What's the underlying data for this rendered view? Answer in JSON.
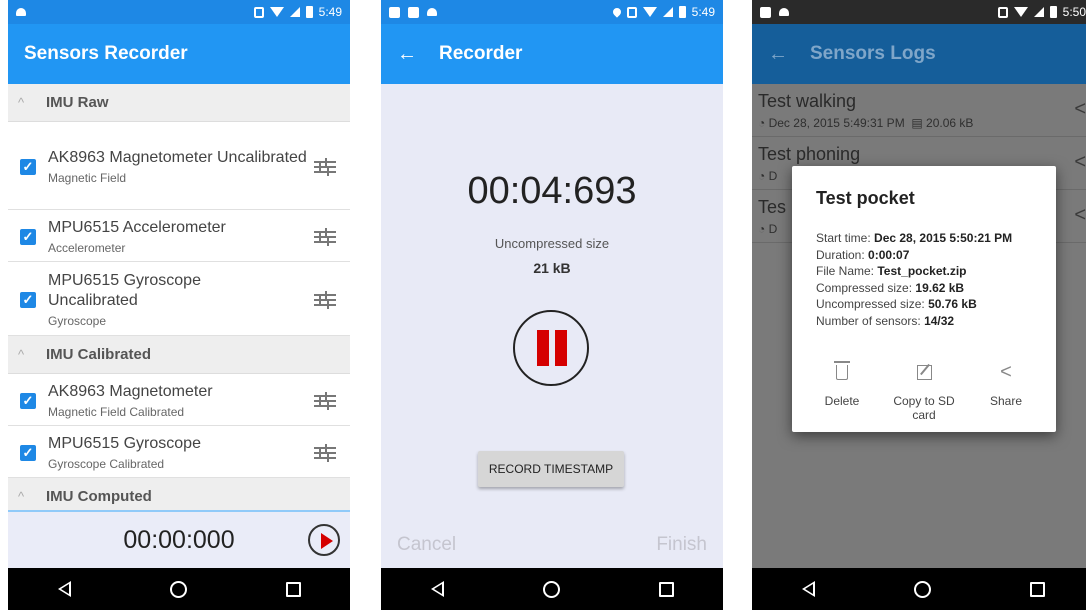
{
  "status": {
    "p1_time": "5:49",
    "p2_time": "5:49",
    "p3_time": "5:50"
  },
  "screen1": {
    "title": "Sensors Recorder",
    "sections": [
      {
        "title": "IMU Raw"
      },
      {
        "title": "IMU Calibrated"
      },
      {
        "title": "IMU Computed"
      }
    ],
    "sensors": [
      {
        "name": "AK8963 Magnetometer Uncalibrated",
        "type": "Magnetic Field",
        "checked": true
      },
      {
        "name": "MPU6515 Accelerometer",
        "type": "Accelerometer",
        "checked": true
      },
      {
        "name": "MPU6515 Gyroscope Uncalibrated",
        "type": "Gyroscope",
        "checked": true
      },
      {
        "name": "AK8963 Magnetometer",
        "type": "Magnetic Field Calibrated",
        "checked": true
      },
      {
        "name": "MPU6515 Gyroscope",
        "type": "Gyroscope Calibrated",
        "checked": true
      }
    ],
    "timer": "00:00:000"
  },
  "screen2": {
    "title": "Recorder",
    "elapsed": "00:04:693",
    "size_label": "Uncompressed size",
    "size_value": "21 kB",
    "timestamp_button": "RECORD TIMESTAMP",
    "cancel": "Cancel",
    "finish": "Finish"
  },
  "screen3": {
    "title": "Sensors Logs",
    "logs": [
      {
        "title": "Test walking",
        "date": "Dec 28, 2015 5:49:31 PM",
        "size": "20.06 kB"
      },
      {
        "title": "Test phoning",
        "date": "D"
      },
      {
        "title": "Tes",
        "date": "D"
      }
    ],
    "dialog": {
      "title": "Test pocket",
      "start_label": "Start time:",
      "start_value": "Dec 28, 2015 5:50:21 PM",
      "duration_label": "Duration:",
      "duration_value": "0:00:07",
      "file_label": "File Name:",
      "file_value": "Test_pocket.zip",
      "compressed_label": "Compressed size:",
      "compressed_value": "19.62 kB",
      "uncompressed_label": "Uncompressed size:",
      "uncompressed_value": "50.76 kB",
      "sensors_label": "Number of sensors:",
      "sensors_value": "14/32",
      "delete": "Delete",
      "copy": "Copy to SD card",
      "share": "Share"
    }
  }
}
